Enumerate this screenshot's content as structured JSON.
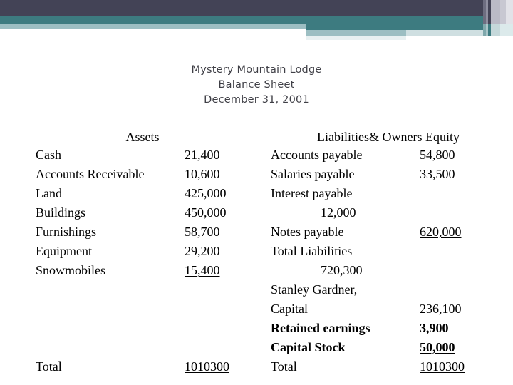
{
  "decor": {
    "colors": {
      "dark_slate": "#434356",
      "teal": "#3d7b80",
      "light_teal": "#9cbec2",
      "pale_teal": "#e8f0f1"
    }
  },
  "title": {
    "line1": "Mystery Mountain Lodge",
    "line2": "Balance Sheet",
    "line3": "December 31, 2001"
  },
  "assets": {
    "header": "Assets",
    "rows": [
      {
        "label": "Cash",
        "value": "21,400",
        "underline": false,
        "bold": false
      },
      {
        "label": "Accounts Receivable",
        "value": "10,600",
        "underline": false,
        "bold": false
      },
      {
        "label": "Land",
        "value": "425,000",
        "underline": false,
        "bold": false
      },
      {
        "label": "Buildings",
        "value": "450,000",
        "underline": false,
        "bold": false
      },
      {
        "label": "Furnishings",
        "value": "58,700",
        "underline": false,
        "bold": false
      },
      {
        "label": "Equipment",
        "value": "29,200",
        "underline": false,
        "bold": false
      },
      {
        "label": "Snowmobiles",
        "value": "15,400",
        "underline": true,
        "bold": false
      }
    ],
    "total_label": "Total",
    "total_value": "1010300"
  },
  "liabilities": {
    "header": "Liabilities& Owners Equity",
    "rows": [
      {
        "label": "Accounts payable",
        "value": "54,800",
        "wrapped": false,
        "underline": false,
        "bold": false
      },
      {
        "label": "Salaries payable",
        "value": "33,500",
        "wrapped": false,
        "underline": false,
        "bold": false
      },
      {
        "label": "Interest payable",
        "value": "12,000",
        "wrapped": true,
        "underline": false,
        "bold": false
      },
      {
        "label": "Notes payable",
        "value": "620,000",
        "wrapped": false,
        "underline": true,
        "bold": false
      },
      {
        "label": "Total Liabilities",
        "value": "720,300",
        "wrapped": true,
        "underline": false,
        "bold": false
      },
      {
        "label": "Stanley Gardner,",
        "value": "",
        "wrapped": false,
        "underline": false,
        "bold": false
      },
      {
        "label": "Capital",
        "value": "236,100",
        "wrapped": false,
        "underline": false,
        "bold": false
      },
      {
        "label": "Retained earnings",
        "value": "3,900",
        "wrapped": false,
        "underline": false,
        "bold": true
      },
      {
        "label": "Capital Stock",
        "value": "50,000",
        "wrapped": false,
        "underline": true,
        "bold": true
      }
    ],
    "total_label": "Total",
    "total_value": "1010300"
  }
}
